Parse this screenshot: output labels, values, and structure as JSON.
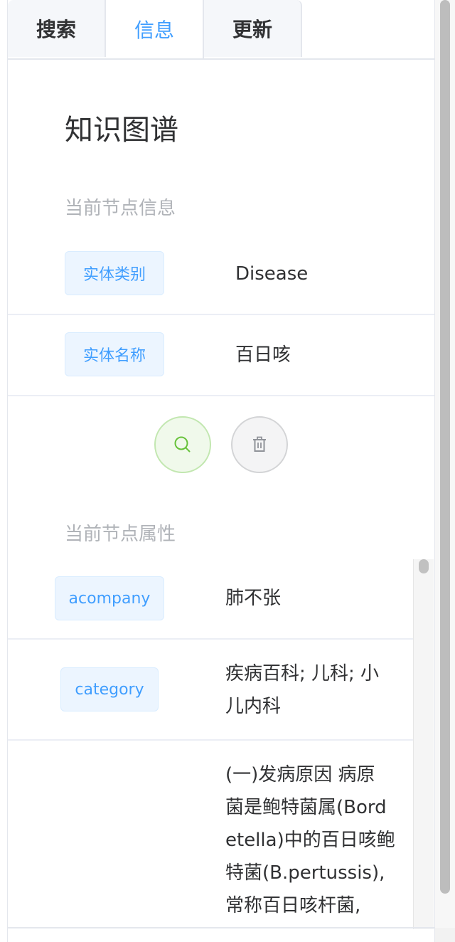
{
  "tabs": [
    {
      "label": "搜索"
    },
    {
      "label": "信息"
    },
    {
      "label": "更新"
    }
  ],
  "title": "知识图谱",
  "node_info": {
    "heading": "当前节点信息",
    "rows": [
      {
        "tag": "实体类别",
        "value": "Disease"
      },
      {
        "tag": "实体名称",
        "value": "百日咳"
      }
    ]
  },
  "actions": {
    "search_icon": "search-icon",
    "delete_icon": "trash-icon"
  },
  "node_props": {
    "heading": "当前节点属性",
    "rows": [
      {
        "tag": "acompany",
        "lines": [
          "肺不张"
        ]
      },
      {
        "tag": "category",
        "lines": [
          "疾病百科; 儿科; 小",
          "儿内科"
        ]
      },
      {
        "tag": "",
        "lines": [
          "(一)发病原因 病原",
          "菌是鲍特菌属(Bord",
          "etella)中的百日咳鲍",
          "特菌(B.pertussis),",
          "常称百日咳杆菌,"
        ]
      }
    ]
  },
  "colors": {
    "accent": "#409eff",
    "success": "#67c23a"
  }
}
